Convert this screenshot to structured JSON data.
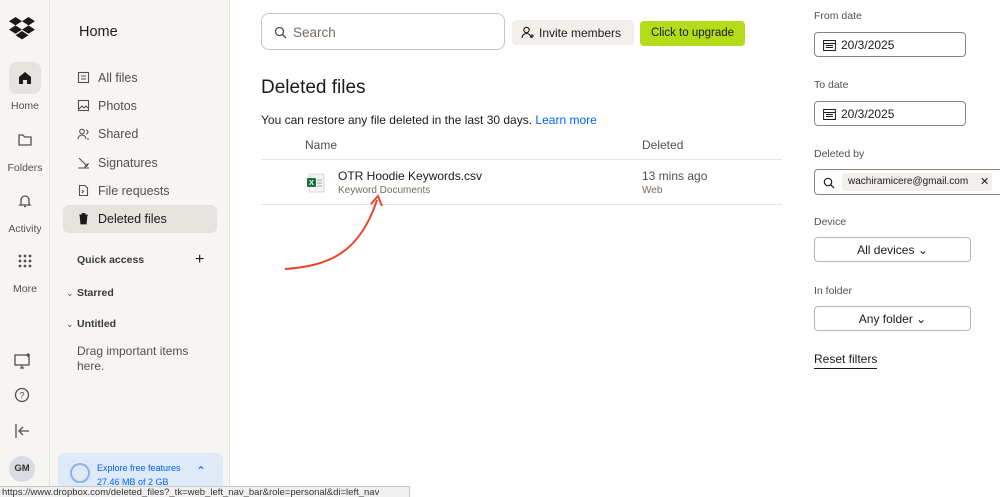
{
  "rail": {
    "items": [
      {
        "label": "Home"
      },
      {
        "label": "Folders"
      },
      {
        "label": "Activity"
      },
      {
        "label": "More"
      }
    ],
    "avatar": "GM"
  },
  "sidebar": {
    "title": "Home",
    "items": [
      {
        "label": "All files",
        "icon": "folder-icon"
      },
      {
        "label": "Photos",
        "icon": "photo-icon"
      },
      {
        "label": "Shared",
        "icon": "shared-icon"
      },
      {
        "label": "Signatures",
        "icon": "signature-icon"
      },
      {
        "label": "File requests",
        "icon": "file-request-icon"
      },
      {
        "label": "Deleted files",
        "icon": "trash-icon"
      }
    ],
    "quick_access": "Quick access",
    "quick_access_add": "+",
    "starred": "Starred",
    "untitled": "Untitled",
    "hint": "Drag important items here.",
    "explore_title": "Explore free features",
    "explore_usage": "27.46 MB of 2 GB"
  },
  "toolbar": {
    "search_placeholder": "Search",
    "invite_label": "Invite members",
    "upgrade_label": "Click to upgrade",
    "upgrade_color": "#b4dc19"
  },
  "main": {
    "title": "Deleted files",
    "subtitle": "You can restore any file deleted in the last 30 days.",
    "learn_more": "Learn more",
    "columns": {
      "name": "Name",
      "deleted": "Deleted"
    },
    "files": [
      {
        "name": "OTR Hoodie Keywords.csv",
        "location": "Keyword Documents",
        "deleted": "13 mins ago",
        "source": "Web",
        "icon": "excel-file-icon"
      }
    ]
  },
  "filters": {
    "from_label": "From date",
    "from_value": "20/3/2025",
    "to_label": "To date",
    "to_value": "20/3/2025",
    "deleted_by_label": "Deleted by",
    "deleted_by_value": "wachiramicere@gmail.com",
    "device_label": "Device",
    "device_value": "All devices",
    "folder_label": "In folder",
    "folder_value": "Any folder",
    "reset_label": "Reset filters"
  },
  "status_bar": "https://www.dropbox.com/deleted_files?_tk=web_left_nav_bar&role=personal&di=left_nav",
  "colors": {
    "accent": "#0061fe",
    "annotation_arrow": "#e8452c"
  }
}
